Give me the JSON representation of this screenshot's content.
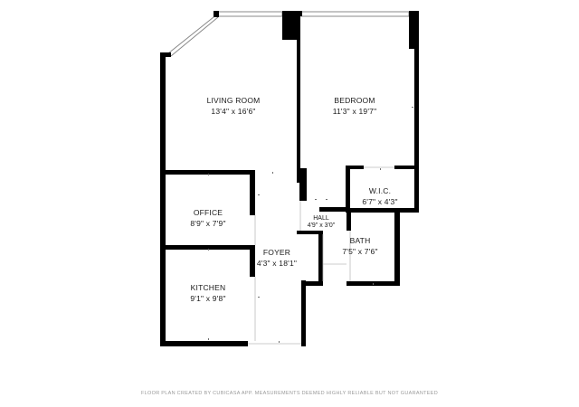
{
  "rooms": [
    {
      "key": "living",
      "name": "LIVING ROOM",
      "size": "13'4\" x 16'6\""
    },
    {
      "key": "bedroom",
      "name": "BEDROOM",
      "size": "11'3\" x 19'7\""
    },
    {
      "key": "wic",
      "name": "W.I.C.",
      "size": "6'7\" x 4'3\""
    },
    {
      "key": "hall",
      "name": "HALL",
      "size": "4'9\" x 3'0\""
    },
    {
      "key": "office",
      "name": "OFFICE",
      "size": "8'9\" x 7'9\""
    },
    {
      "key": "bath",
      "name": "BATH",
      "size": "7'5\" x 7'6\""
    },
    {
      "key": "foyer",
      "name": "FOYER",
      "size": "4'3\" x 18'1\""
    },
    {
      "key": "kitchen",
      "name": "KITCHEN",
      "size": "9'1\" x 9'8\""
    }
  ],
  "footer": "FLOOR PLAN CREATED BY CUBICASA APP. MEASUREMENTS DEEMED HIGHLY RELIABLE BUT NOT GUARANTEED"
}
